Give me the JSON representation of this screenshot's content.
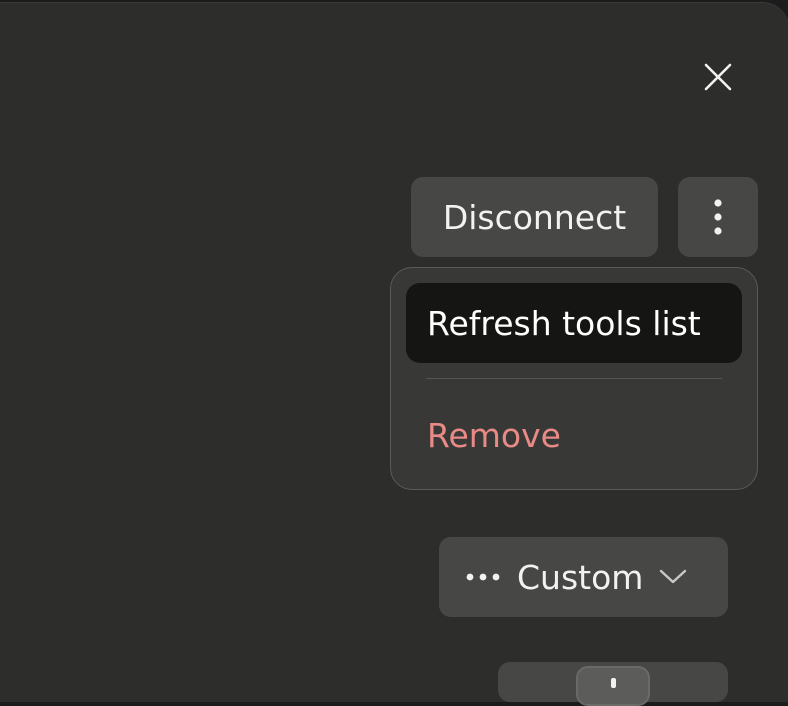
{
  "header": {
    "close_icon": "close-icon"
  },
  "actions": {
    "disconnect_label": "Disconnect",
    "more_icon": "more-vertical-icon"
  },
  "menu": {
    "items": [
      {
        "label": "Refresh tools list",
        "state": "highlighted"
      },
      {
        "label": "Remove",
        "color": "#e88a86"
      }
    ]
  },
  "permissions": {
    "icon": "more-horizontal-icon",
    "selected_label": "Custom",
    "chevron_icon": "chevron-down-icon"
  },
  "colors": {
    "panel_bg": "#2d2d2b",
    "button_bg": "#474745",
    "menu_bg": "#383836",
    "highlight_bg": "#151514",
    "danger": "#e88a86"
  }
}
